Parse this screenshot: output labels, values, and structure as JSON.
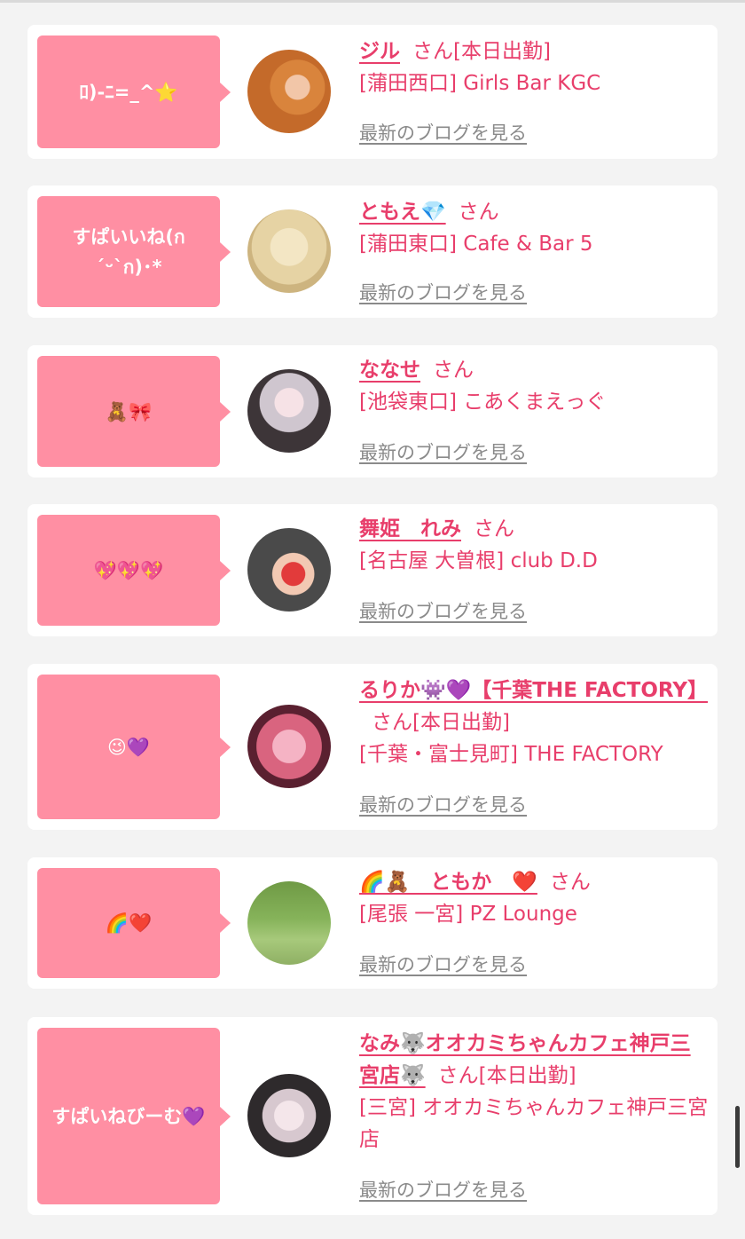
{
  "blog_link_label": "最新のブログを見る",
  "san_label": "さん",
  "entries": [
    {
      "comment": "ﾛ)-ﾆ=_^⭐",
      "name": "ジル",
      "status": "[本日出勤]",
      "shop": "[蒲田西口] Girls Bar KGC",
      "avatar_icon": "avatar-photo"
    },
    {
      "comment": "すぱいいね(ก´ᵕ`ก)･*",
      "name": "ともえ💎",
      "status": "",
      "shop": "[蒲田東口] Cafe & Bar 5",
      "avatar_icon": "avatar-sketch"
    },
    {
      "comment": "🧸🎀",
      "name": "ななせ",
      "status": "",
      "shop": "[池袋東口] こあくまえっぐ",
      "avatar_icon": "avatar-photo"
    },
    {
      "comment": "💖💖💖",
      "name": "舞姫　れみ",
      "status": "",
      "shop": "[名古屋 大曽根] club D.D",
      "avatar_icon": "avatar-photo"
    },
    {
      "comment": "😉💜",
      "name": "るりか👾💜【千葉THE FACTORY】",
      "status": "[本日出勤]",
      "shop": "[千葉・富士見町] THE FACTORY",
      "avatar_icon": "avatar-photo"
    },
    {
      "comment": "🌈❤️",
      "name": "🌈🧸　ともか　❤️",
      "status": "",
      "shop": "[尾張 一宮] PZ Lounge",
      "avatar_icon": "avatar-photo"
    },
    {
      "comment": "すぱいねびーむ💜",
      "name": "なみ🐺オオカミちゃんカフェ神戸三宮店🐺",
      "status": "[本日出勤]",
      "shop": "[三宮] オオカミちゃんカフェ神戸三宮店",
      "avatar_icon": "avatar-photo"
    }
  ]
}
